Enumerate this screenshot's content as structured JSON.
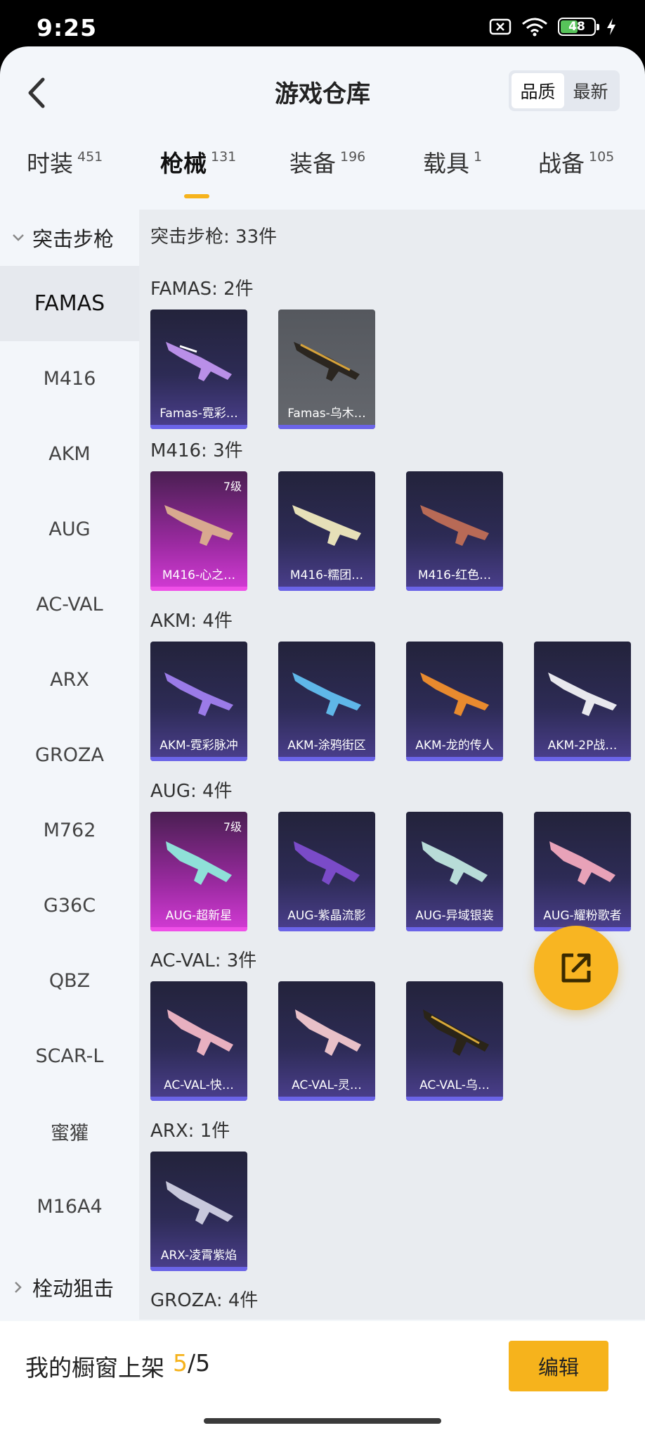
{
  "status_bar": {
    "time": "9:25",
    "battery": "48"
  },
  "header": {
    "title": "游戏仓库",
    "sort_quality": "品质",
    "sort_newest": "最新"
  },
  "tabs": [
    {
      "label": "时装",
      "count": "451"
    },
    {
      "label": "枪械",
      "count": "131"
    },
    {
      "label": "装备",
      "count": "196"
    },
    {
      "label": "载具",
      "count": "1"
    },
    {
      "label": "战备",
      "count": "105"
    }
  ],
  "sidebar": {
    "category": "突击步枪",
    "items": [
      "FAMAS",
      "M416",
      "AKM",
      "AUG",
      "AC-VAL",
      "ARX",
      "GROZA",
      "M762",
      "G36C",
      "QBZ",
      "SCAR-L",
      "蜜獾",
      "M16A4"
    ],
    "next_category": "栓动狙击"
  },
  "content": {
    "summary": "突击步枪: 33件",
    "sections": [
      {
        "title": "FAMAS: 2件",
        "items": [
          {
            "name": "Famas-霓彩…",
            "level": ""
          },
          {
            "name": "Famas-乌木…",
            "level": ""
          }
        ]
      },
      {
        "title": "M416: 3件",
        "items": [
          {
            "name": "M416-心之…",
            "level": "7级"
          },
          {
            "name": "M416-糯团…",
            "level": ""
          },
          {
            "name": "M416-红色…",
            "level": ""
          }
        ]
      },
      {
        "title": "AKM: 4件",
        "items": [
          {
            "name": "AKM-霓彩脉冲",
            "level": ""
          },
          {
            "name": "AKM-涂鸦街区",
            "level": ""
          },
          {
            "name": "AKM-龙的传人",
            "level": ""
          },
          {
            "name": "AKM-2P战…",
            "level": ""
          }
        ]
      },
      {
        "title": "AUG: 4件",
        "items": [
          {
            "name": "AUG-超新星",
            "level": "7级"
          },
          {
            "name": "AUG-紫晶流影",
            "level": ""
          },
          {
            "name": "AUG-异域银装",
            "level": ""
          },
          {
            "name": "AUG-耀粉歌者",
            "level": ""
          }
        ]
      },
      {
        "title": "AC-VAL: 3件",
        "items": [
          {
            "name": "AC-VAL-快…",
            "level": ""
          },
          {
            "name": "AC-VAL-灵…",
            "level": ""
          },
          {
            "name": "AC-VAL-乌…",
            "level": ""
          }
        ]
      },
      {
        "title": "ARX: 1件",
        "items": [
          {
            "name": "ARX-凌霄紫焰",
            "level": ""
          }
        ]
      },
      {
        "title": "GROZA: 4件",
        "items": []
      }
    ]
  },
  "bottom": {
    "shelf_label": "我的橱窗上架",
    "shelf_current": "5",
    "shelf_total": "/5",
    "edit": "编辑"
  },
  "colors": {
    "accent": "#f6b31c",
    "card_bar": "#6b64e8",
    "legendary": "#d43bd6"
  }
}
